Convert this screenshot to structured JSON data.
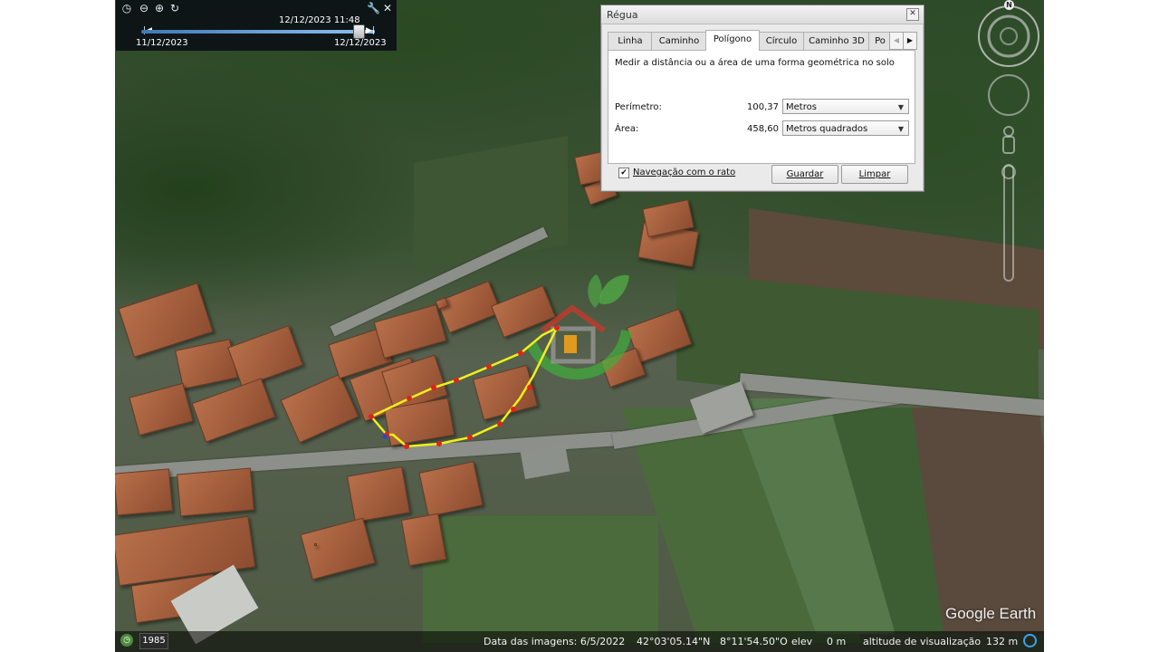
{
  "time_slider": {
    "current": "12/12/2023  11:48",
    "start": "11/12/2023",
    "end": "12/12/2023"
  },
  "ruler": {
    "title": "Régua",
    "close": "✕",
    "tabs": [
      "Linha",
      "Caminho",
      "Polígono",
      "Círculo",
      "Caminho 3D",
      "Po"
    ],
    "active_tab": "Polígono",
    "description": "Medir a distância ou a área de uma forma geométrica no solo",
    "perimeter": {
      "label": "Perímetro:",
      "value": "100,37",
      "unit": "Metros"
    },
    "area": {
      "label": "Área:",
      "value": "458,60",
      "unit": "Metros quadrados"
    },
    "mouse_nav": {
      "label": "Navegação com o rato",
      "checked": true
    },
    "save_label": "Guardar",
    "clear_label": "Limpar"
  },
  "status_bar": {
    "historical_year": "1985",
    "image_date": "Data das imagens: 6/5/2022",
    "latitude": "42°03'05.14\"N",
    "longitude": "8°11'54.50\"O",
    "elev_label": "elev",
    "elev_value": "0 m",
    "eye_alt_label": "altitude de visualização",
    "eye_alt_value": "132 m"
  },
  "brand": "Google Earth",
  "compass": {
    "north": "N"
  },
  "colors": {
    "polygon_line": "#f2ef1a",
    "vertex": "#e0231b",
    "dialog_bg": "#eaeaea",
    "toolbar_bg": "#0a0e14"
  },
  "icons": [
    "clock-icon",
    "zoom-out-icon",
    "zoom-in-icon",
    "refresh-icon",
    "wrench-icon",
    "close-icon",
    "compass-icon",
    "look-joystick-icon",
    "move-joystick-icon",
    "street-view-pegman-icon",
    "zoom-slider-icon"
  ]
}
